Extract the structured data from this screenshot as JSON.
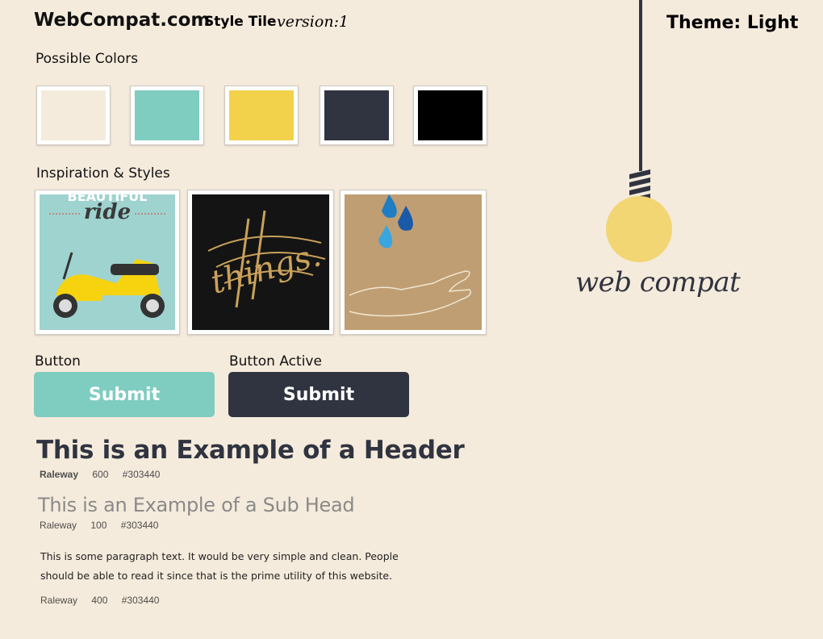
{
  "header": {
    "brand": "WebCompat.com",
    "tile_title": "Style Tile",
    "version": "version:1",
    "theme": "Theme: Light"
  },
  "colors": {
    "label": "Possible Colors",
    "swatches": [
      "#f5ebdc",
      "#7fccc1",
      "#f2d24b",
      "#303440",
      "#000000"
    ]
  },
  "inspiration": {
    "label": "Inspiration & Styles",
    "images": [
      {
        "icon": "scooter-poster-image",
        "text": "ride"
      },
      {
        "icon": "gold-lettering-image",
        "text": "things."
      },
      {
        "icon": "raindrop-hand-image"
      }
    ]
  },
  "buttons": {
    "button_label": "Button",
    "button_active_label": "Button Active",
    "submit": "Submit",
    "submit_active": "Submit",
    "colors": {
      "normal": "#7fccc1",
      "active": "#303440"
    }
  },
  "typography": {
    "header_example": "This is an Example of a Header",
    "header_font": "Raleway",
    "header_weight": "600",
    "header_color": "#303440",
    "subhead_example": "This is an Example of a Sub Head",
    "subhead_font": "Raleway",
    "subhead_weight": "100",
    "subhead_color": "#303440",
    "paragraph": "This is some paragraph text.  It would be very simple and clean.  People should be able to read it since that is the prime utility of this website.",
    "paragraph_font": "Raleway",
    "paragraph_weight": "400",
    "paragraph_color": "#303440"
  },
  "logo": {
    "text": "web compat",
    "icon": "lightbulb-icon"
  }
}
